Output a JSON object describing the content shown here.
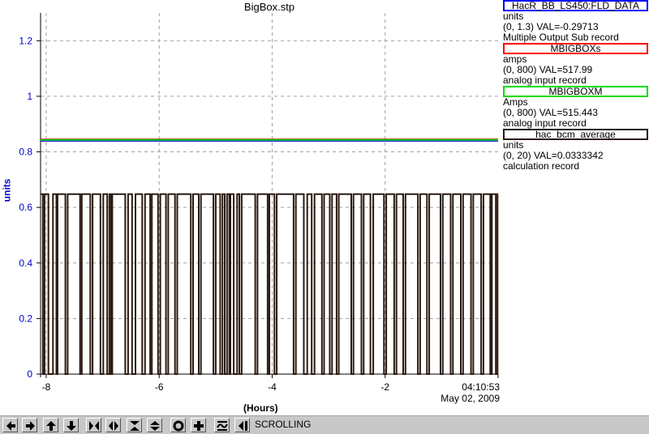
{
  "chart_data": {
    "type": "line",
    "title": "BigBox.stp",
    "xlabel": "(Hours)",
    "ylabel": "units",
    "xlim": [
      -8.1,
      0
    ],
    "ylim": [
      0,
      1.3
    ],
    "x_ticks": [
      -8,
      -6,
      -4,
      -2
    ],
    "y_ticks": [
      0,
      0.2,
      0.4,
      0.6,
      0.8,
      1,
      1.2
    ],
    "grid": true,
    "time_label": "04:10:53",
    "date_label": "May 02, 2009",
    "series": [
      {
        "name": "HacR_BB_LS450:FLD_DATA",
        "color": "#0000ff",
        "x": [
          -8.1,
          0
        ],
        "y": [
          0.84,
          0.84
        ]
      },
      {
        "name": "MBIGBOXs",
        "color": "#ff0000",
        "x": [
          -8.1,
          0
        ],
        "y": [
          0.845,
          0.845
        ]
      },
      {
        "name": "MBIGBOXM",
        "color": "#00dd00",
        "x": [
          -8.1,
          0
        ],
        "y": [
          0.843,
          0.843
        ]
      },
      {
        "name": "hac_bcm_average",
        "color": "#2a1a10",
        "high": 0.648,
        "low": 0,
        "x_range": [
          -8.1,
          0
        ],
        "dropouts": [
          [
            -8.06,
            -8.03
          ],
          [
            -7.96,
            -7.88
          ],
          [
            -7.82,
            -7.8
          ],
          [
            -7.66,
            -7.62
          ],
          [
            -7.4,
            -7.37
          ],
          [
            -7.22,
            -7.18
          ],
          [
            -7.04,
            -6.99
          ],
          [
            -6.92,
            -6.88
          ],
          [
            -6.85,
            -6.83
          ],
          [
            -6.6,
            -6.55
          ],
          [
            -6.48,
            -6.42
          ],
          [
            -6.3,
            -6.25
          ],
          [
            -6.16,
            -6.13
          ],
          [
            -6.02,
            -5.98
          ],
          [
            -5.88,
            -5.84
          ],
          [
            -5.72,
            -5.68
          ],
          [
            -5.44,
            -5.4
          ],
          [
            -5.3,
            -5.26
          ],
          [
            -5.04,
            -5.0
          ],
          [
            -4.92,
            -4.88
          ],
          [
            -4.84,
            -4.8
          ],
          [
            -4.76,
            -4.74
          ],
          [
            -4.68,
            -4.62
          ],
          [
            -4.58,
            -4.54
          ],
          [
            -4.3,
            -4.26
          ],
          [
            -4.08,
            -4.05
          ],
          [
            -3.96,
            -3.92
          ],
          [
            -3.62,
            -3.58
          ],
          [
            -3.44,
            -3.38
          ],
          [
            -3.3,
            -3.25
          ],
          [
            -3.12,
            -3.08
          ],
          [
            -2.98,
            -2.94
          ],
          [
            -2.86,
            -2.82
          ],
          [
            -2.6,
            -2.56
          ],
          [
            -2.42,
            -2.38
          ],
          [
            -2.26,
            -2.21
          ],
          [
            -2.02,
            -1.98
          ],
          [
            -1.84,
            -1.8
          ],
          [
            -1.68,
            -1.64
          ],
          [
            -1.42,
            -1.38
          ],
          [
            -1.26,
            -1.22
          ],
          [
            -1.02,
            -0.98
          ],
          [
            -0.84,
            -0.8
          ],
          [
            -0.66,
            -0.62
          ],
          [
            -0.48,
            -0.44
          ],
          [
            -0.3,
            -0.26
          ],
          [
            -0.14,
            -0.11
          ],
          [
            -0.04,
            -0.01
          ]
        ]
      }
    ]
  },
  "legend": [
    {
      "name": "HacR_BB_LS450:FLD_DATA",
      "color": "#0000ff",
      "units": "units",
      "range": "(0, 1.3) VAL=-0.29713",
      "type": "Multiple Output Sub record"
    },
    {
      "name": "MBIGBOXs",
      "color": "#ff0000",
      "units": "amps",
      "range": "(0, 800) VAL=517.99",
      "type": "analog input record"
    },
    {
      "name": "MBIGBOXM",
      "color": "#00dd00",
      "units": "Amps",
      "range": "(0, 800) VAL=515.443",
      "type": "analog input record"
    },
    {
      "name": "hac_bcm_average",
      "color": "#2a1a10",
      "units": "units",
      "range": "(0, 20) VAL=0.0333342",
      "type": "calculation record"
    }
  ],
  "toolbar": {
    "status": "SCROLLING",
    "buttons": [
      {
        "name": "arrow-left-icon"
      },
      {
        "name": "arrow-right-icon"
      },
      {
        "name": "arrow-up-icon"
      },
      {
        "name": "arrow-down-icon"
      },
      {
        "name": "zoom-in-horizontal-icon"
      },
      {
        "name": "zoom-out-horizontal-icon"
      },
      {
        "name": "zoom-in-vertical-icon"
      },
      {
        "name": "zoom-out-vertical-icon"
      },
      {
        "name": "stop-icon"
      },
      {
        "name": "add-icon"
      },
      {
        "name": "autoscale-icon"
      },
      {
        "name": "scroll-mode-icon"
      }
    ]
  }
}
